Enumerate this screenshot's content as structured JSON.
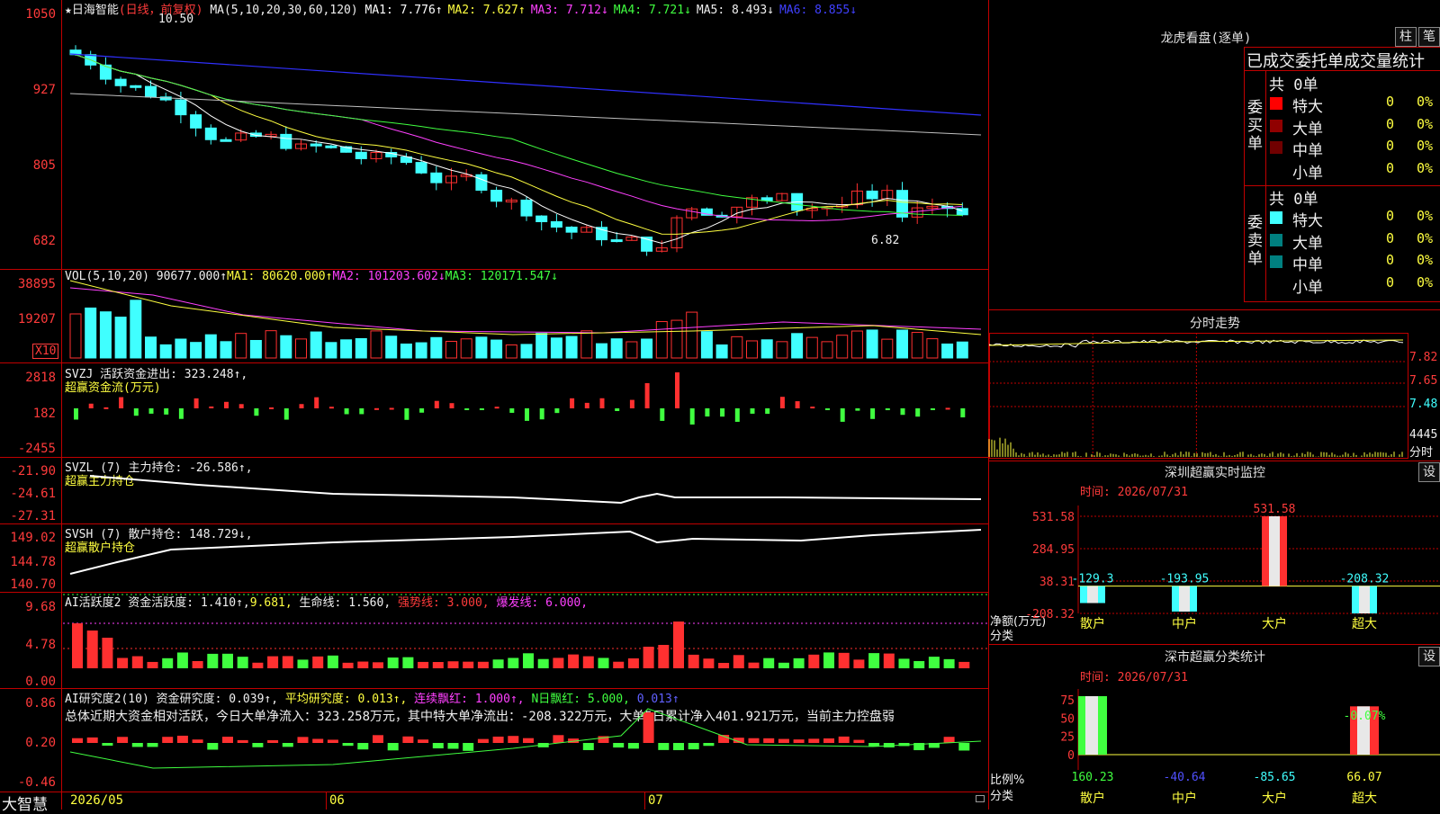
{
  "header": {
    "stock_name": "★日海智能",
    "period": "(日线，前复权)",
    "ma_title": "MA(5,10,20,30,60,120)",
    "ma": [
      {
        "label": "MA1: 7.776↑",
        "color": "#ffffff"
      },
      {
        "label": "MA2: 7.627↑",
        "color": "#ffff40"
      },
      {
        "label": "MA3: 7.712↓",
        "color": "#ff40ff"
      },
      {
        "label": "MA4: 7.721↓",
        "color": "#40ff40"
      },
      {
        "label": "MA5: 8.493↓",
        "color": "#f0f0f0"
      },
      {
        "label": "MA6: 8.855↓",
        "color": "#4040ff"
      }
    ],
    "high_marker": "10.50",
    "low_marker": "6.82"
  },
  "price_axis": [
    "1050",
    "927",
    "805",
    "682"
  ],
  "volume": {
    "title": "VOL(5,10,20)",
    "value": "90677.000↑",
    "ma1": "MA1: 80620.000↑",
    "ma2": "MA2: 101203.602↓",
    "ma3": "MA3: 120171.547↓",
    "axis": [
      "38895",
      "19207"
    ],
    "unit": "X10"
  },
  "svzj": {
    "title": "SVZJ  活跃资金进出: 323.248↑,",
    "subtitle": "超赢资金流(万元)",
    "axis": [
      "2818",
      "182",
      "-2455"
    ]
  },
  "svzl": {
    "title": "SVZL (7) 主力持仓: -26.586↑,",
    "subtitle": "超赢主力持仓",
    "axis": [
      "-21.90",
      "-24.61",
      "-27.31"
    ]
  },
  "svsh": {
    "title": "SVSH (7) 散户持仓: 148.729↓,",
    "subtitle": "超赢散户持仓",
    "axis": [
      "149.02",
      "144.78",
      "140.70"
    ]
  },
  "ai_active": {
    "title": "AI活跃度2 资金活跃度: 1.410↑,",
    "v2": "9.681,",
    "v3": "生命线: 1.560,",
    "v4": "强势线: 3.000,",
    "v5": "爆发线: 6.000,",
    "axis": [
      "9.68",
      "4.78",
      "0.00"
    ]
  },
  "ai_research": {
    "title": "AI研究度2(10) 资金研究度: 0.039↑,",
    "v2": "平均研究度: 0.013↑,",
    "v3": "连续飘红: 1.000↑,",
    "v4": "N日飘红: 5.000,",
    "v5": "0.013↑",
    "summary": "总体近期大资金相对活跃，今日大单净流入：323.258万元，其中特大单净流出：-208.322万元，大单5日累计净入401.921万元，当前主力控盘弱",
    "axis": [
      "0.86",
      "0.20",
      "-0.46"
    ]
  },
  "bottom": {
    "brand": "大智慧",
    "dates": [
      "2026/05",
      "06",
      "07"
    ]
  },
  "dragon": {
    "title": "龙虎看盘(逐单)",
    "btn1": "柱",
    "btn2": "笔",
    "table_title": "已成交委托单成交量统计",
    "buy_label": "委买单",
    "sell_label": "委卖单",
    "buy_total": "共 0单",
    "sell_total": "共 0单",
    "buy_rows": [
      {
        "label": "特大",
        "n": "0",
        "pct": "0%",
        "color": "#ff0000"
      },
      {
        "label": "大单",
        "n": "0",
        "pct": "0%",
        "color": "#900000"
      },
      {
        "label": "中单",
        "n": "0",
        "pct": "0%",
        "color": "#700000"
      },
      {
        "label": "小单",
        "n": "0",
        "pct": "0%",
        "color": ""
      }
    ],
    "sell_rows": [
      {
        "label": "特大",
        "n": "0",
        "pct": "0%",
        "color": "#40ffff"
      },
      {
        "label": "大单",
        "n": "0",
        "pct": "0%",
        "color": "#008080"
      },
      {
        "label": "中单",
        "n": "0",
        "pct": "0%",
        "color": "#008080"
      },
      {
        "label": "小单",
        "n": "0",
        "pct": "0%",
        "color": ""
      }
    ]
  },
  "intraday": {
    "title": "分时走势",
    "axis": [
      "7.82",
      "7.65",
      "7.48"
    ],
    "vol_axis": "4445",
    "vol_label": "分时"
  },
  "monitor": {
    "title": "深圳超赢实时监控",
    "btn": "设",
    "time": "时间: 2026/07/31",
    "axis": [
      "531.58",
      "284.95",
      "38.31",
      "-208.32"
    ],
    "y_label": "净额(万元)",
    "x_label": "分类",
    "categories": [
      "散户",
      "中户",
      "大户",
      "超大"
    ],
    "values": [
      -129.3,
      -193.95,
      531.58,
      -208.32
    ],
    "value_labels": [
      "-129.3",
      "-193.95",
      "531.58",
      "-208.32"
    ]
  },
  "classify": {
    "title": "深市超赢分类统计",
    "btn": "设",
    "time": "时间: 2026/07/31",
    "axis": [
      "75",
      "50",
      "25",
      "0"
    ],
    "y_label": "比例%",
    "x_label": "分类",
    "categories": [
      "散户",
      "中户",
      "大户",
      "超大"
    ],
    "values": [
      160.23,
      -40.64,
      -85.65,
      66.07
    ],
    "value_labels": [
      "160.23",
      "-40.64",
      "-85.65",
      "66.07"
    ],
    "top_label": "-0.07%"
  },
  "chart_data": {
    "type": "bar",
    "title": "深圳超赢实时监控",
    "categories": [
      "散户",
      "中户",
      "大户",
      "超大"
    ],
    "values": [
      -129.3,
      -193.95,
      531.58,
      -208.32
    ],
    "ylabel": "净额(万元)",
    "ylim": [
      -208.32,
      531.58
    ]
  }
}
